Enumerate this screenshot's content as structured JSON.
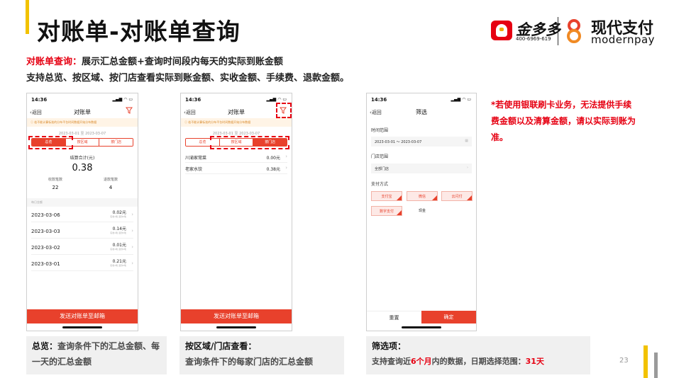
{
  "header": {
    "title": "对账单-对账单查询",
    "logo1_name": "金多多",
    "logo1_phone": "400-6969-619",
    "logo2_cn": "现代支付",
    "logo2_en": "modernpay"
  },
  "intro": {
    "label": "对账单查询：",
    "text": "展示汇总金额+查询时间段内每天的实际到账金额",
    "line2": "支持总览、按区域、按门店查看实际到账金额、实收金额、手续费、退款金额。"
  },
  "common": {
    "time": "14:36",
    "back": "返回",
    "notice": "若不能计算标准的分布平台时间数据开始分布数据",
    "send_button": "发送对账单至邮箱"
  },
  "phone1": {
    "title": "对账单",
    "date_range": "2023-03-01 至 2023-03-07",
    "tabs": [
      "总览",
      "按区域",
      "按门店"
    ],
    "active_tab": 0,
    "sum_label": "结算合计(元)",
    "sum_value": "0.38",
    "count_label_left": "收款笔数",
    "count_value_left": "22",
    "count_label_right": "退款笔数",
    "count_value_right": "4",
    "section_head": "每日金额",
    "days": [
      {
        "date": "2023-03-06",
        "amount": "0.02元",
        "sub": "实收1笔 退款0笔"
      },
      {
        "date": "2023-03-03",
        "amount": "0.14元",
        "sub": "实收1笔 退款0笔"
      },
      {
        "date": "2023-03-02",
        "amount": "0.01元",
        "sub": "实收1笔 退款0笔"
      },
      {
        "date": "2023-03-01",
        "amount": "0.21元",
        "sub": "实收1笔 退款0笔"
      }
    ]
  },
  "phone2": {
    "title": "对账单",
    "date_range": "2023-03-01 至 2023-03-07",
    "tabs": [
      "总览",
      "按区域",
      "按门店"
    ],
    "active_tab": 2,
    "stores": [
      {
        "name": "川渝家常菜",
        "amount": "0.00元"
      },
      {
        "name": "老家水饺",
        "amount": "0.38元"
      }
    ]
  },
  "phone3": {
    "title": "筛选",
    "time_label": "时间范围",
    "time_value": "2023-03-01 ～ 2023-03-07",
    "store_label": "门店范围",
    "store_value": "全部门店",
    "pay_label": "支付方式",
    "pay_options": [
      "支付宝",
      "微信",
      "云闪付",
      "数字支付",
      "现金"
    ],
    "reset": "重置",
    "confirm": "确定"
  },
  "note": "*若使用银联刷卡业务，无法提供手续费金额以及清算金额，请以实际到账为准。",
  "captions": {
    "c1_title": "总览：",
    "c1_desc": "查询条件下的汇总金额、每一天的汇总金额",
    "c2_title": "按区域/门店查看：",
    "c2_desc": "查询条件下的每家门店的汇总金额",
    "c3_title": "筛选项：",
    "c3_pre": "支持查询近",
    "c3_hl1": "6个月",
    "c3_mid": "内的数据，日期选择范围：",
    "c3_hl2": "31天"
  },
  "page_number": "23",
  "colors": {
    "accent": "#e8412c",
    "brand_red": "#e60012",
    "brand_yellow": "#f2c200"
  }
}
